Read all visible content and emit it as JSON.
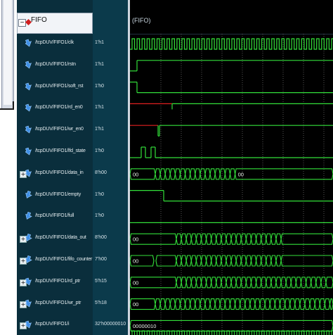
{
  "group": {
    "label": "FIFO",
    "wave_label": "(FIFO)"
  },
  "colors": {
    "wave_green": "#33e03a",
    "wave_red": "#e02020",
    "cursor": "#c0d0e0",
    "grid": "#8c8c8c"
  },
  "signals": [
    {
      "name": "/tcpDUV/FIFO1/clk",
      "value": "1'h1",
      "bus": false,
      "icon": "input-arrow-icon"
    },
    {
      "name": "/tcpDUV/FIFO1/rstn",
      "value": "1'h1",
      "bus": false,
      "icon": "input-arrow-icon"
    },
    {
      "name": "/tcpDUV/FIFO1/soft_rst",
      "value": "1'h0",
      "bus": false,
      "icon": "input-arrow-icon"
    },
    {
      "name": "/tcpDUV/FIFO1/rd_en0",
      "value": "1'h1",
      "bus": false,
      "icon": "input-arrow-icon"
    },
    {
      "name": "/tcpDUV/FIFO1/wr_en0",
      "value": "1'h1",
      "bus": false,
      "icon": "input-arrow-icon"
    },
    {
      "name": "/tcpDUV/FIFO1/lfd_state",
      "value": "1'h0",
      "bus": false,
      "icon": "input-arrow-icon"
    },
    {
      "name": "/tcpDUV/FIFO1/data_in",
      "value": "8'h00",
      "bus": true,
      "icon": "input-arrow-icon"
    },
    {
      "name": "/tcpDUV/FIFO1/empty",
      "value": "1'h0",
      "bus": false,
      "icon": "output-arrow-icon"
    },
    {
      "name": "/tcpDUV/FIFO1/full",
      "value": "1'h0",
      "bus": false,
      "icon": "output-arrow-icon"
    },
    {
      "name": "/tcpDUV/FIFO1/data_out",
      "value": "8'h00",
      "bus": true,
      "icon": "output-arrow-icon"
    },
    {
      "name": "/tcpDUV/FIFO1/fifo_counter",
      "value": "7'h00",
      "bus": true,
      "icon": "output-arrow-icon"
    },
    {
      "name": "/tcpDUV/FIFO1/rd_ptr",
      "value": "5'h15",
      "bus": true,
      "icon": "input-arrow-icon"
    },
    {
      "name": "/tcpDUV/FIFO1/wr_ptr",
      "value": "5'h18",
      "bus": true,
      "icon": "input-arrow-icon"
    },
    {
      "name": "/tcpDUV/FIFO1/i",
      "value": "32'h00000010",
      "bus": true,
      "icon": "input-arrow-icon"
    }
  ],
  "wave_texts": {
    "data_in_start": "00",
    "data_in_end": "00",
    "data_out_start": "00",
    "fifo_counter_start": "00",
    "rd_ptr_start": "00",
    "wr_ptr_start": "00",
    "i_start": "00000010"
  }
}
